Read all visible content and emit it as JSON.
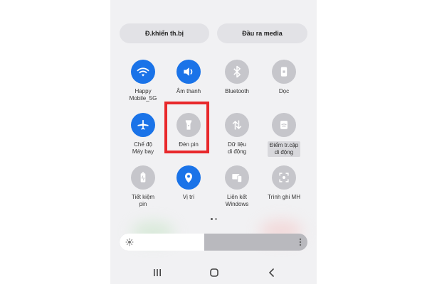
{
  "header": {
    "device_control": "Đ.khiển th.bị",
    "media_output": "Đầu ra media"
  },
  "tiles": [
    {
      "icon": "wifi-icon",
      "label": "Happy\nMobile_5G",
      "state": "on"
    },
    {
      "icon": "volume-icon",
      "label": "Âm thanh",
      "state": "on"
    },
    {
      "icon": "bluetooth-icon",
      "label": "Bluetooth",
      "state": "off"
    },
    {
      "icon": "portrait-rotation-icon",
      "label": "Dọc",
      "state": "off"
    },
    {
      "icon": "airplane-icon",
      "label": "Chế độ\nMáy bay",
      "state": "on"
    },
    {
      "icon": "flashlight-icon",
      "label": "Đèn pin",
      "state": "off"
    },
    {
      "icon": "mobile-data-icon",
      "label": "Dữ liệu\ndi động",
      "state": "off"
    },
    {
      "icon": "hotspot-icon",
      "label": "Điểm tr.cập\ndi động",
      "state": "off"
    },
    {
      "icon": "battery-saver-icon",
      "label": "Tiết kiệm\npin",
      "state": "off"
    },
    {
      "icon": "location-icon",
      "label": "Vị trí",
      "state": "on"
    },
    {
      "icon": "link-windows-icon",
      "label": "Liên kết\nWindows",
      "state": "off"
    },
    {
      "icon": "screen-recorder-icon",
      "label": "Trình ghi MH",
      "state": "off"
    }
  ],
  "brightness": {
    "level": 0.45
  },
  "pagination": {
    "pages": 2,
    "current": 0
  },
  "colors": {
    "accent": "#1a73e8",
    "highlight": "#e8282b",
    "inactive": "#c6c6cb"
  }
}
